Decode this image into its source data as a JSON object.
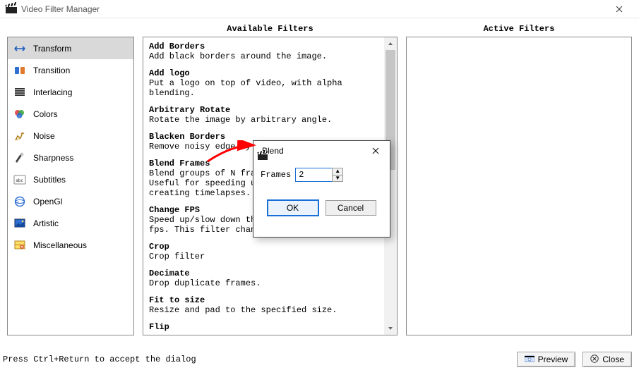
{
  "window": {
    "title": "Video Filter Manager"
  },
  "categories": {
    "items": [
      {
        "label": "Transform",
        "icon": "transform"
      },
      {
        "label": "Transition",
        "icon": "transition"
      },
      {
        "label": "Interlacing",
        "icon": "interlacing"
      },
      {
        "label": "Colors",
        "icon": "colors"
      },
      {
        "label": "Noise",
        "icon": "noise"
      },
      {
        "label": "Sharpness",
        "icon": "sharpness"
      },
      {
        "label": "Subtitles",
        "icon": "subtitles"
      },
      {
        "label": "OpenGl",
        "icon": "opengl"
      },
      {
        "label": "Artistic",
        "icon": "artistic"
      },
      {
        "label": "Miscellaneous",
        "icon": "misc"
      }
    ],
    "selected_index": 0
  },
  "headers": {
    "available": "Available Filters",
    "active": "Active Filters"
  },
  "filters": [
    {
      "title": "Add Borders",
      "desc": "Add black borders around the image."
    },
    {
      "title": "Add logo",
      "desc": "Put a logo on top of video, with alpha blending."
    },
    {
      "title": "Arbitrary Rotate",
      "desc": "Rotate the image by arbitrary angle."
    },
    {
      "title": "Blacken Borders",
      "desc": "Remove noisy edge by turning them to black."
    },
    {
      "title": "Blend Frames",
      "desc": "Blend groups of N frames into a single frame. Useful for speeding up slow-motion footage or creating timelapses."
    },
    {
      "title": "Change FPS",
      "desc": "Speed up/slow down the video as if altering fps. This filter changes duration."
    },
    {
      "title": "Crop",
      "desc": "Crop filter"
    },
    {
      "title": "Decimate",
      "desc": "Drop duplicate frames."
    },
    {
      "title": "Fit to size",
      "desc": "Resize and pad to the specified size."
    },
    {
      "title": "Flip",
      "desc": ""
    }
  ],
  "dialog": {
    "title": "Blend",
    "field_label": "Frames",
    "value": "2",
    "ok": "OK",
    "cancel": "Cancel"
  },
  "footer": {
    "hint": "Press Ctrl+Return to accept the dialog",
    "preview": "Preview",
    "close": "Close"
  }
}
